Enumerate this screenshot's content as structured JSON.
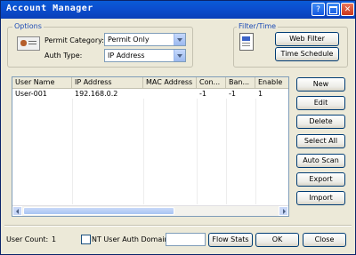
{
  "window": {
    "title": "Account Manager"
  },
  "options": {
    "group_label": "Options",
    "permit_category_label": "Permit Category:",
    "permit_category_value": "Permit Only",
    "auth_type_label": "Auth Type:",
    "auth_type_value": "IP Address"
  },
  "filter_time": {
    "group_label": "Filter/Time",
    "web_filter_label": "Web Filter",
    "time_schedule_label": "Time Schedule"
  },
  "table": {
    "columns": [
      "User Name",
      "IP Address",
      "MAC Address",
      "Con...",
      "Ban...",
      "Enable"
    ],
    "rows": [
      {
        "user_name": "User-001",
        "ip_address": "192.168.0.2",
        "mac_address": "",
        "con": "-1",
        "ban": "-1",
        "enable": "1"
      }
    ]
  },
  "side_buttons": {
    "new": "New",
    "edit": "Edit",
    "delete": "Delete",
    "select_all": "Select All",
    "auto_scan": "Auto Scan",
    "export": "Export",
    "import": "Import"
  },
  "footer": {
    "user_count_label": "User Count:",
    "user_count_value": "1",
    "nt_auth_label": "NT User Auth Domain:",
    "nt_auth_value": "",
    "flow_stats_label": "Flow Stats",
    "ok_label": "OK",
    "close_label": "Close"
  }
}
